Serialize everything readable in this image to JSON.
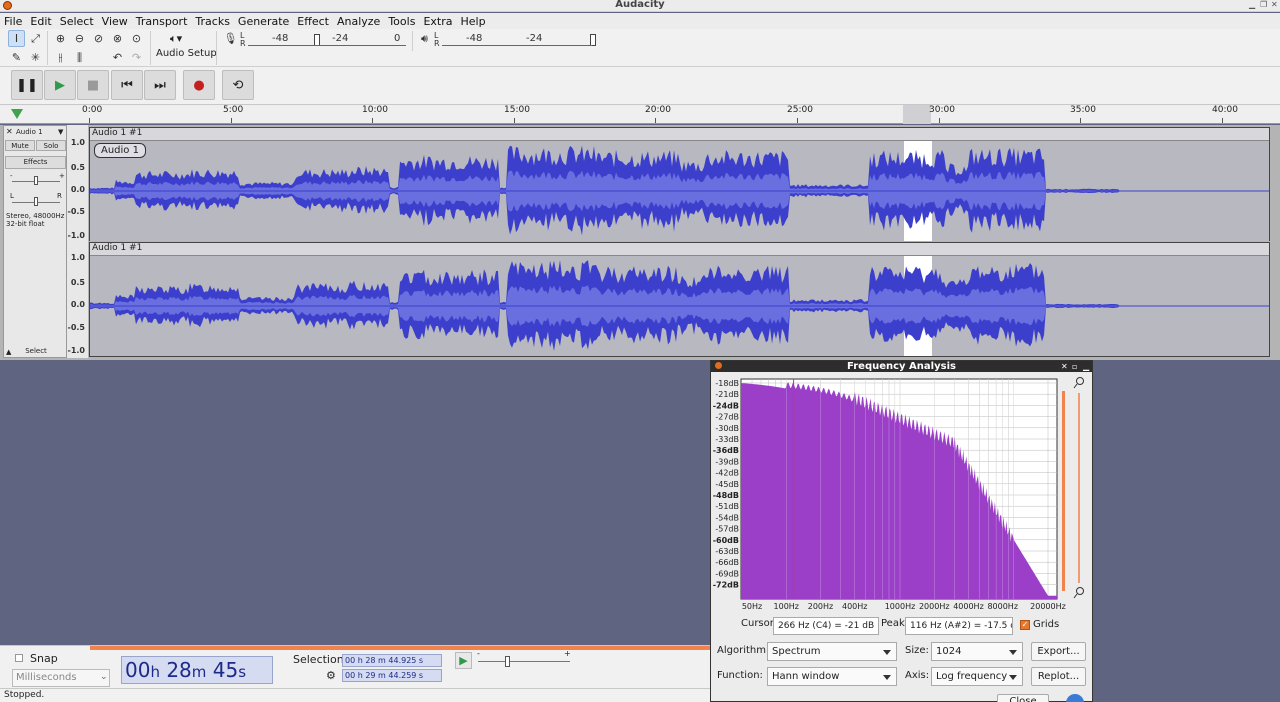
{
  "window": {
    "title": "Audacity"
  },
  "menu": [
    "File",
    "Edit",
    "Select",
    "View",
    "Transport",
    "Tracks",
    "Generate",
    "Effect",
    "Analyze",
    "Tools",
    "Extra",
    "Help"
  ],
  "toolbar": {
    "audio_setup_label": "Audio Setup",
    "rec_meter_ticks": [
      "-48",
      "-24",
      "0"
    ],
    "play_meter_ticks": [
      "-48",
      "-24"
    ],
    "meter_lr": [
      "L",
      "R"
    ]
  },
  "ruler": {
    "ticks": [
      "0:00",
      "5:00",
      "10:00",
      "15:00",
      "20:00",
      "25:00",
      "30:00",
      "35:00",
      "40:00"
    ]
  },
  "track": {
    "name": "Audio 1",
    "clip_name": "Audio 1 #1",
    "label_text": "Audio 1",
    "mute_label": "Mute",
    "solo_label": "Solo",
    "effects_label": "Effects",
    "format_line1": "Stereo, 48000Hz",
    "format_line2": "32-bit float",
    "select_label": "Select",
    "vruler": [
      "1.0",
      "0.5",
      "0.0",
      "-0.5",
      "-1.0"
    ],
    "pan_l": "L",
    "pan_r": "R"
  },
  "freq_analysis": {
    "title": "Frequency Analysis",
    "db_labels": [
      "-18dB",
      "-21dB",
      "-24dB",
      "-27dB",
      "-30dB",
      "-33dB",
      "-36dB",
      "-39dB",
      "-42dB",
      "-45dB",
      "-48dB",
      "-51dB",
      "-54dB",
      "-57dB",
      "-60dB",
      "-63dB",
      "-66dB",
      "-69dB",
      "-72dB"
    ],
    "freq_labels": [
      "50Hz",
      "100Hz",
      "200Hz",
      "400Hz",
      "1000Hz",
      "2000Hz",
      "4000Hz",
      "8000Hz",
      "20000Hz"
    ],
    "cursor_label": "Cursor:",
    "cursor_value": "266 Hz (C4) = -21 dB",
    "peak_label": "Peak:",
    "peak_value": "116 Hz (A#2) = -17.5 d",
    "grids_label": "Grids",
    "algorithm_label": "Algorithm:",
    "algorithm_value": "Spectrum",
    "size_label": "Size:",
    "size_value": "1024",
    "export_label": "Export...",
    "function_label": "Function:",
    "function_value": "Hann window",
    "axis_label": "Axis:",
    "axis_value": "Log frequency",
    "replot_label": "Replot...",
    "close_label": "Close",
    "spectrum_color": "#9b3fc8"
  },
  "selection_bar": {
    "snap_label": "Snap",
    "snap_unit": "Milliseconds",
    "time_h": "00",
    "time_m": "28",
    "time_s": "45",
    "u_h": "h",
    "u_m": "m",
    "u_s": "s",
    "selection_label": "Selection",
    "sel_start": "00 h 28 m 44.925 s",
    "sel_end": "00 h 29 m 44.259 s"
  },
  "status": {
    "text": "Stopped."
  },
  "colors": {
    "waveform": "#3b3fcc",
    "waveform_rms": "#6a6fe0",
    "accent": "#f0824d"
  }
}
